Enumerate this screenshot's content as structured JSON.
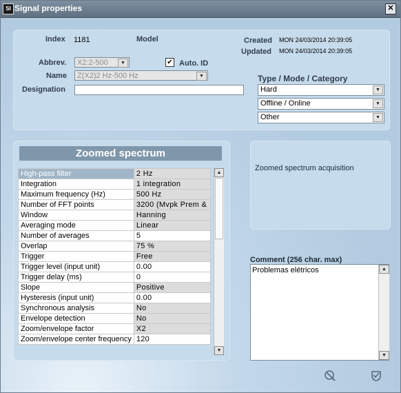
{
  "window": {
    "title": "Signal properties",
    "app_icon": "app-logo-icon",
    "close_glyph": "✕"
  },
  "header": {
    "index_label": "Index",
    "index_value": "1181",
    "model_label": "Model",
    "created_label": "Created",
    "created_value": "MON 24/03/2014 20:39:05",
    "updated_label": "Updated",
    "updated_value": "MON 24/03/2014 20:39:05",
    "abbrev_label": "Abbrev.",
    "abbrev_value": "X2:2-500",
    "auto_id_label": "Auto. ID",
    "auto_id_checked": "✔",
    "name_label": "Name",
    "name_value": "Z(X2)2 Hz-500 Hz",
    "designation_label": "Designation",
    "designation_value": "",
    "type_label": "Type / Mode / Category",
    "type_value": "Hard",
    "mode_value": "Offline / Online",
    "category_value": "Other"
  },
  "spectrum": {
    "title": "Zoomed spectrum",
    "rows": [
      {
        "name": "High-pass filter",
        "value": "2 Hz"
      },
      {
        "name": "Integration",
        "value": "1 integration"
      },
      {
        "name": "Maximum frequency (Hz)",
        "value": "500 Hz"
      },
      {
        "name": "Number of FFT points",
        "value": "3200 (Mvpk Prem &"
      },
      {
        "name": "Window",
        "value": "Hanning"
      },
      {
        "name": "Averaging mode",
        "value": "Linear"
      },
      {
        "name": "Number of averages",
        "value": "5"
      },
      {
        "name": "Overlap",
        "value": "75 %"
      },
      {
        "name": "Trigger",
        "value": "Free"
      },
      {
        "name": "Trigger level (input unit)",
        "value": "0.00"
      },
      {
        "name": "Trigger delay (ms)",
        "value": "0"
      },
      {
        "name": "Slope",
        "value": "Positive"
      },
      {
        "name": "Hysteresis (input unit)",
        "value": "0.00"
      },
      {
        "name": "Synchronous analysis",
        "value": "No"
      },
      {
        "name": "Envelope detection",
        "value": "No"
      },
      {
        "name": "Zoom/envelope factor",
        "value": "X2"
      },
      {
        "name": "Zoom/envelope center frequency",
        "value": "120"
      }
    ]
  },
  "info": {
    "description": "Zoomed spectrum acquisition"
  },
  "comment": {
    "label": "Comment (256 char. max)",
    "value": "Problemas elétricos"
  },
  "icons": {
    "cancel": "cancel-icon",
    "ok": "ok-icon"
  },
  "colors": {
    "titlebar": "#6f8091",
    "panel": "#c6dbec",
    "grid_title": "#7f97ab",
    "selected_row": "#a0b6c8"
  }
}
